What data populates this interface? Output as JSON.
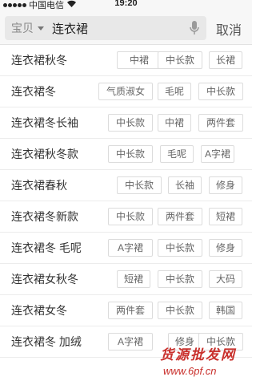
{
  "status_bar": {
    "carrier": "中国电信",
    "time": "19:20"
  },
  "search": {
    "scope": "宝贝",
    "query": "连衣裙",
    "cancel_label": "取消"
  },
  "suggestions": [
    {
      "label": "连衣裙秋冬",
      "tags": [
        "中裙",
        "中长款",
        "长裙"
      ]
    },
    {
      "label": "连衣裙冬",
      "tags": [
        "气质淑女",
        "毛呢",
        "中长款"
      ]
    },
    {
      "label": "连衣裙冬长袖",
      "tags": [
        "中长款",
        "中裙",
        "两件套"
      ]
    },
    {
      "label": "连衣裙秋冬款",
      "tags": [
        "中长款",
        "毛呢",
        "A字裙"
      ]
    },
    {
      "label": "连衣裙春秋",
      "tags": [
        "中长款",
        "长袖",
        "修身"
      ]
    },
    {
      "label": "连衣裙冬新款",
      "tags": [
        "中长款",
        "两件套",
        "短裙"
      ]
    },
    {
      "label": "连衣裙冬 毛呢",
      "tags": [
        "A字裙",
        "中长款",
        "修身"
      ]
    },
    {
      "label": "连衣裙女秋冬",
      "tags": [
        "短裙",
        "中长款",
        "大码"
      ]
    },
    {
      "label": "连衣裙女冬",
      "tags": [
        "两件套",
        "中长款",
        "韩国"
      ]
    },
    {
      "label": "连衣裙冬 加绒",
      "tags": [
        "A字裙",
        "修身",
        "中长款"
      ]
    }
  ],
  "watermark": {
    "text": "货源批发网",
    "url": "www.6pf.cn"
  }
}
